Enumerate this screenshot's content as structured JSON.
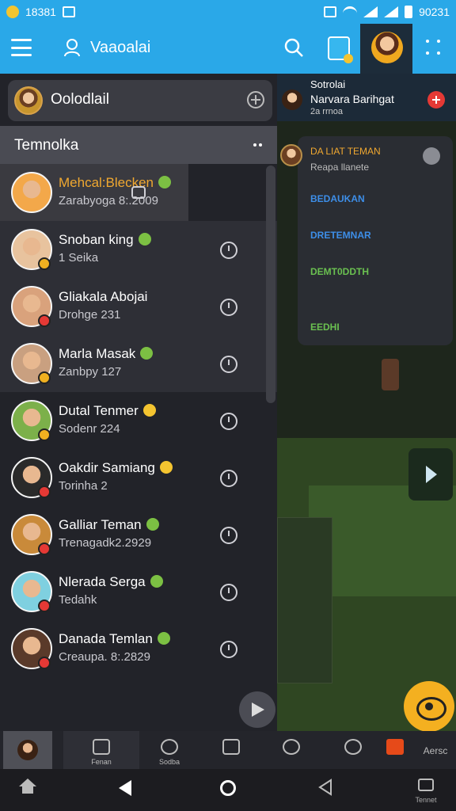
{
  "status_bar": {
    "time_left": "18381",
    "time_right": "90231"
  },
  "app_bar": {
    "title": "Vaaoalai"
  },
  "profile": {
    "name": "Oolodlail"
  },
  "section": {
    "title": "Temnolka"
  },
  "contacts": [
    {
      "name": "Mehcal:Blecken",
      "sub": "Zarabyoga 8:.2009",
      "name_color": "#f0a830",
      "emoji_color": "#7cc043",
      "badge": ""
    },
    {
      "name": "Snoban king",
      "sub": "1 Seika",
      "name_color": "#ffffff",
      "emoji_color": "#7cc043",
      "badge": "#f0b020"
    },
    {
      "name": "Gliakala Abojai",
      "sub": "Drohge 231",
      "name_color": "#ffffff",
      "emoji_color": "",
      "badge": "#e53935"
    },
    {
      "name": "Marla Masak",
      "sub": "Zanbpy 127",
      "name_color": "#ffffff",
      "emoji_color": "#7cc043",
      "badge": "#f0b020"
    },
    {
      "name": "Dutal Tenmer",
      "sub": "Sodenr 224",
      "name_color": "#ffffff",
      "emoji_color": "#f4c430",
      "badge": "#f0b020"
    },
    {
      "name": "Oakdir Samiang",
      "sub": "Torinha 2",
      "name_color": "#ffffff",
      "emoji_color": "#f4c430",
      "badge": "#e53935"
    },
    {
      "name": "Galliar Teman",
      "sub": "Trenagadk2.2929",
      "name_color": "#ffffff",
      "emoji_color": "#7cc043",
      "badge": "#e53935"
    },
    {
      "name": "Nlerada Serga",
      "sub": "Tedahk",
      "name_color": "#ffffff",
      "emoji_color": "#7cc043",
      "badge": "#e53935"
    },
    {
      "name": "Danada Temlan",
      "sub": "Creaupa. 8:.2829",
      "name_color": "#ffffff",
      "emoji_color": "#7cc043",
      "badge": "#e53935"
    }
  ],
  "notification": {
    "line1": "Sotrolai",
    "line2": "Narvara Barihgat",
    "line3": "2a rrnoa"
  },
  "popup": {
    "title": "DA LIAT TEMAN",
    "subtitle": "Reapa llanete",
    "options": [
      "BEDAUKAN",
      "DRETEMNAR",
      "DEMT0DDTH",
      "EEDHI"
    ]
  },
  "tabs": [
    {
      "label": ""
    },
    {
      "label": "Fenan"
    },
    {
      "label": "Sodba"
    },
    {
      "label": ""
    },
    {
      "label": ""
    },
    {
      "label": ""
    },
    {
      "label": ""
    },
    {
      "label": "Aersc"
    }
  ],
  "system_nav": {
    "home_label": "",
    "recent_label": "Tennet"
  }
}
